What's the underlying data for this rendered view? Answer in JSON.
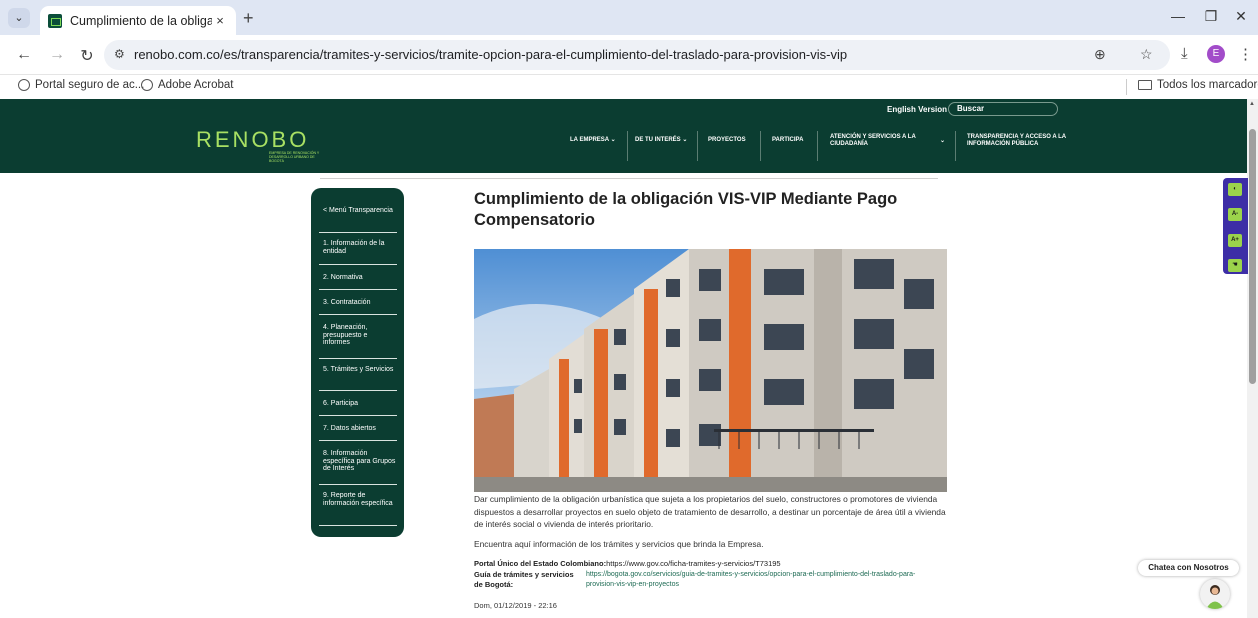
{
  "browser": {
    "tab_title": "Cumplimiento de la obligación",
    "tab_close": "×",
    "new_tab": "+",
    "url": "renobo.com.co/es/transparencia/tramites-y-servicios/tramite-opcion-para-el-cumplimiento-del-traslado-para-provision-vis-vip",
    "profile_initial": "E",
    "bookmarks": [
      "Portal seguro de ac...",
      "Adobe Acrobat"
    ],
    "bookmarks_folder": "Todos los marcadores"
  },
  "header": {
    "logo": "RENOBO",
    "logo_sub": "EMPRESA DE RENOVACIÓN Y DESARROLLO URBANO DE BOGOTÁ",
    "english": "English Version",
    "search_placeholder": "Buscar",
    "menu": [
      "LA EMPRESA",
      "DE TU INTERÉS",
      "PROYECTOS",
      "PARTICIPA",
      "ATENCIÓN Y SERVICIOS A LA CIUDADANÍA",
      "TRANSPARENCIA Y ACCESO A LA INFORMACIÓN PÚBLICA"
    ]
  },
  "sidebar": {
    "items": [
      "< Menú Transparencia",
      "1. Información de la entidad",
      "2. Normativa",
      "3. Contratación",
      "4. Planeación, presupuesto e informes",
      "5. Trámites y Servicios",
      "6. Participa",
      "7. Datos abiertos",
      "8. Información específica para Grupos de Interés",
      "9. Reporte de información específica"
    ]
  },
  "content": {
    "title": "Cumplimiento de la obligación VIS-VIP Mediante Pago Compensatorio",
    "description": "Dar cumplimiento de la obligación urbanística que sujeta a los propietarios del suelo, constructores o promotores de vivienda dispuestos a desarrollar proyectos en suelo objeto de tratamiento de desarrollo, a destinar un porcentaje de área útil a vivienda de interés social o vivienda de interés prioritario.",
    "description2": "Encuentra aquí información de los trámites y servicios que brinda la Empresa.",
    "portal_label": "Portal Único del Estado Colombiano:",
    "portal_link": "https://www.gov.co/ficha-tramites-y-servicios/T73195",
    "guia_label": "Guía de trámites y servicios de Bogotá:",
    "guia_link": "https://bogota.gov.co/servicios/guia-de-tramites-y-servicios/opcion-para-el-cumplimiento-del-traslado-para-provision-vis-vip-en-proyectos",
    "date": "Dom, 01/12/2019 - 22:16"
  },
  "a11y": [
    "A-",
    "A+"
  ],
  "chat": "Chatea con Nosotros",
  "colors": {
    "brand_green": "#0b3d31",
    "accent_lime": "#a8e063",
    "a11y_purple": "#3d2ea6"
  }
}
